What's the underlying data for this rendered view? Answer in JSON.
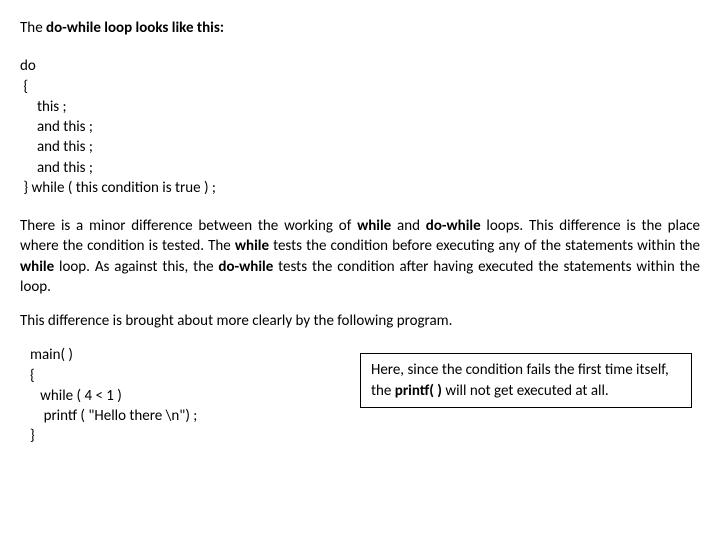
{
  "heading": {
    "pre": "The ",
    "bold": "do-while loop looks like this:"
  },
  "code1": "do\n {\n     this ;\n     and this ;\n     and this ;\n     and this ;\n } while ( this condition is true ) ;",
  "para1": {
    "t1": "There is a minor difference between the working of ",
    "b1": "while",
    "t2": " and ",
    "b2": "do-while",
    "t3": " loops. This difference is the place where the condition is tested. The ",
    "b3": "while",
    "t4": " tests the condition before executing any of the statements within the ",
    "b4": "while",
    "t5": " loop. As against this, the ",
    "b5": "do-while",
    "t6": " tests the condition after having executed the statements within the loop."
  },
  "para2": "This difference is brought about more clearly by the following program.",
  "code2": "main( )\n{\n   while ( 4 < 1 )\n    printf ( \"Hello there \\n\") ;\n}",
  "note": {
    "t1": "Here, since the condition fails the first time itself, the ",
    "b1": "printf( )",
    "t2": " will not get executed at all."
  }
}
